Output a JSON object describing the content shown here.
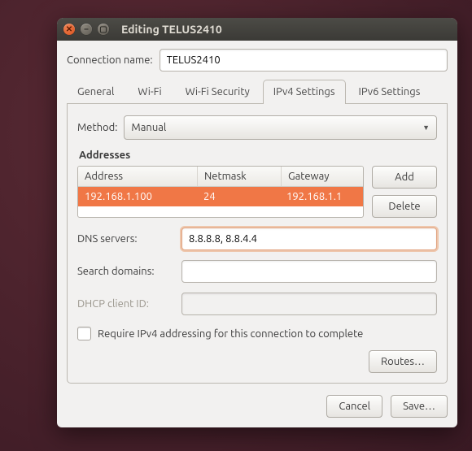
{
  "window": {
    "title": "Editing TELUS2410"
  },
  "connection_name_label": "Connection name:",
  "connection_name_value": "TELUS2410",
  "tabs": {
    "general": "General",
    "wifi": "Wi-Fi",
    "wifi_security": "Wi-Fi Security",
    "ipv4": "IPv4 Settings",
    "ipv6": "IPv6 Settings"
  },
  "ipv4": {
    "method_label": "Method:",
    "method_value": "Manual",
    "addresses_heading": "Addresses",
    "columns": {
      "address": "Address",
      "netmask": "Netmask",
      "gateway": "Gateway"
    },
    "row": {
      "address": "192.168.1.100",
      "netmask": "24",
      "gateway": "192.168.1.1"
    },
    "add_label": "Add",
    "delete_label": "Delete",
    "dns_label": "DNS servers:",
    "dns_value": "8.8.8.8, 8.8.4.4",
    "search_label": "Search domains:",
    "search_value": "",
    "dhcp_label": "DHCP client ID:",
    "dhcp_value": "",
    "require_label": "Require IPv4 addressing for this connection to complete",
    "routes_label": "Routes…"
  },
  "buttons": {
    "cancel": "Cancel",
    "save": "Save…"
  }
}
